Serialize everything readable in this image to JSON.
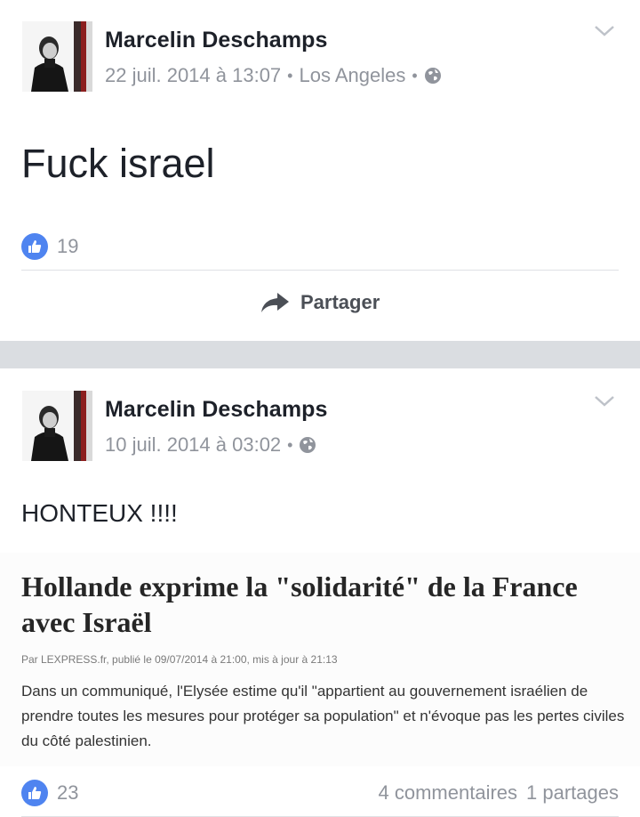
{
  "posts": [
    {
      "author": "Marcelin Deschamps",
      "timestamp": "22 juil. 2014 à 13:07",
      "location": "Los Angeles",
      "privacy_icon": "globe-icon",
      "text": "Fuck israel",
      "likes": "19",
      "share_label": "Partager"
    },
    {
      "author": "Marcelin Deschamps",
      "timestamp": "10 juil. 2014 à 03:02",
      "privacy_icon": "globe-icon",
      "text": "HONTEUX !!!!",
      "likes": "23",
      "comments": "4 commentaires",
      "shares": "1 partages",
      "article": {
        "title": "Hollande exprime la \"solidarité\" de la France avec Israël",
        "byline": "Par LEXPRESS.fr, publié le 09/07/2014 à 21:00, mis à jour à 21:13",
        "body": "Dans un communiqué, l'Elysée estime qu'il \"appartient au gouvernement israélien de prendre toutes les mesures pour protéger sa population\" et n'évoque pas les pertes civiles du côté palestinien."
      }
    }
  ],
  "colors": {
    "like_blue": "#4f84f0",
    "meta_gray": "#90949c",
    "separator": "#dadde1"
  }
}
